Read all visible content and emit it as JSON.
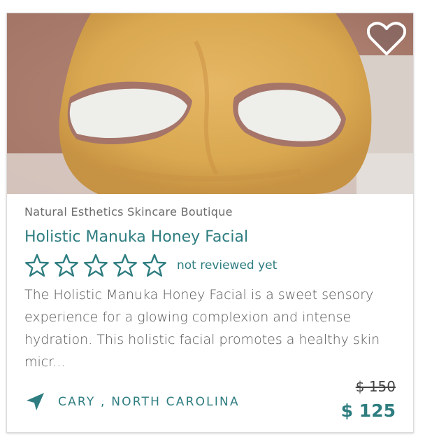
{
  "card": {
    "provider": "Natural Esthetics Skincare Boutique",
    "title": "Holistic Manuka Honey Facial",
    "rating": {
      "stars": 5,
      "filled": 0,
      "label": "not reviewed yet"
    },
    "description": "The Holistic Manuka Honey Facial is a sweet sensory experience for a glowing complexion and intense hydration. This holistic facial promotes a healthy skin micr...",
    "location": "CARY , NORTH CAROLINA",
    "price_original": "$ 150",
    "price_sale": "$ 125",
    "favorite_icon": "heart-icon",
    "location_icon": "navigation-arrow-icon"
  },
  "colors": {
    "accent": "#2e7d80",
    "text_muted": "#6b6b6b",
    "mask": "#d9a850"
  }
}
